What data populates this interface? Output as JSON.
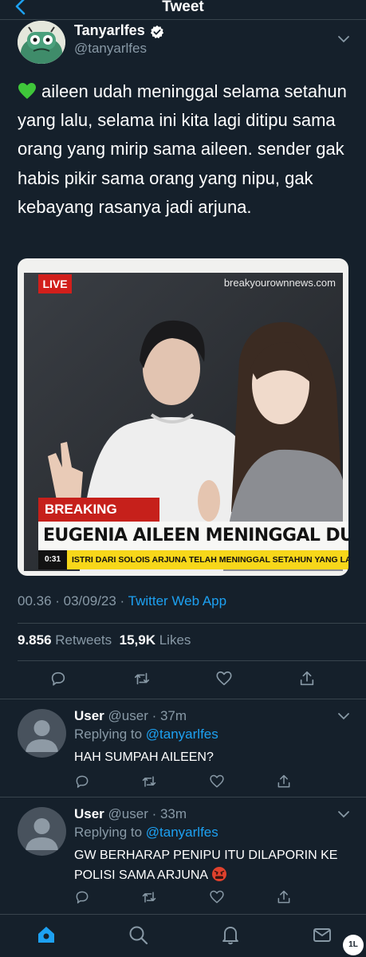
{
  "header": {
    "title": "Tweet"
  },
  "tweet": {
    "author_name": "Tanyarlfes",
    "author_handle": "@tanyarlfes",
    "text": "aileen udah meninggal selama setahun yang lalu, selama ini kita lagi ditipu sama orang yang mirip sama aileen. sender gak habis pikir sama orang yang nipu, gak kebayang rasanya jadi arjuna.",
    "time": "00.36 · 03/09/23 · ",
    "app": "Twitter Web App",
    "retweets_count": "9.856",
    "retweets_label": "Retweets",
    "likes_count": "15,9K",
    "likes_label": "Likes"
  },
  "media": {
    "live": "LIVE",
    "source": "breakyourownnews.com",
    "breaking_label": "BREAKING NEWS",
    "headline": "EUGENIA AILEEN MENINGGAL DUNIA",
    "ticker_time": "0:31",
    "ticker_text": "ISTRI DARI SOLOIS ARJUNA TELAH MENINGGAL SETAHUN YANG LALU"
  },
  "replies": [
    {
      "name": "User",
      "handle_time": "@user · 37m",
      "replying_prefix": "Replying to",
      "replying_to": "@tanyarlfes",
      "text": "HAH SUMPAH AILEEN?"
    },
    {
      "name": "User",
      "handle_time": "@user · 33m",
      "replying_prefix": "Replying to",
      "replying_to": "@tanyarlfes",
      "text": "GW BERHARAP PENIPU ITU DILAPORIN KE POLISI SAMA ARJUNA"
    }
  ],
  "watermark": "1L",
  "colors": {
    "background": "#15202b",
    "accent": "#1da1f2",
    "muted": "#8899a6",
    "divider": "#38444d"
  },
  "icons": [
    "back-arrow-icon",
    "verified-icon",
    "chevron-down-icon",
    "green-heart-emoji",
    "reply-icon",
    "retweet-icon",
    "like-icon",
    "share-icon",
    "home-icon",
    "search-icon",
    "notifications-icon",
    "messages-icon",
    "angry-face-emoji"
  ]
}
